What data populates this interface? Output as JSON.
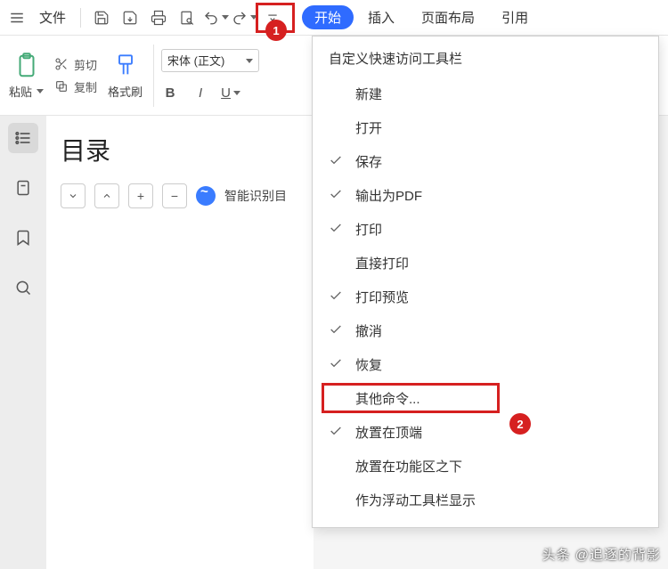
{
  "topbar": {
    "file_label": "文件",
    "tab_active": "开始",
    "tabs": [
      "插入",
      "页面布局",
      "引用"
    ]
  },
  "ribbon": {
    "paste_label": "粘贴",
    "cut_label": "剪切",
    "copy_label": "复制",
    "format_painter_label": "格式刷",
    "font_name": "宋体 (正文)",
    "bold": "B",
    "italic": "I",
    "underline": "U"
  },
  "doc": {
    "title": "目录",
    "smart_label": "智能识别目"
  },
  "menu": {
    "header": "自定义快速访问工具栏",
    "items": [
      {
        "label": "新建",
        "checked": false
      },
      {
        "label": "打开",
        "checked": false
      },
      {
        "label": "保存",
        "checked": true
      },
      {
        "label": "输出为PDF",
        "checked": true
      },
      {
        "label": "打印",
        "checked": true
      },
      {
        "label": "直接打印",
        "checked": false
      },
      {
        "label": "打印预览",
        "checked": true
      },
      {
        "label": "撤消",
        "checked": true
      },
      {
        "label": "恢复",
        "checked": true
      },
      {
        "label": "其他命令...",
        "checked": false,
        "highlight": true
      },
      {
        "label": "放置在顶端",
        "checked": true
      },
      {
        "label": "放置在功能区之下",
        "checked": false
      },
      {
        "label": "作为浮动工具栏显示",
        "checked": false
      }
    ]
  },
  "badges": {
    "one": "1",
    "two": "2"
  },
  "watermark": "头条 @追逐的背影"
}
